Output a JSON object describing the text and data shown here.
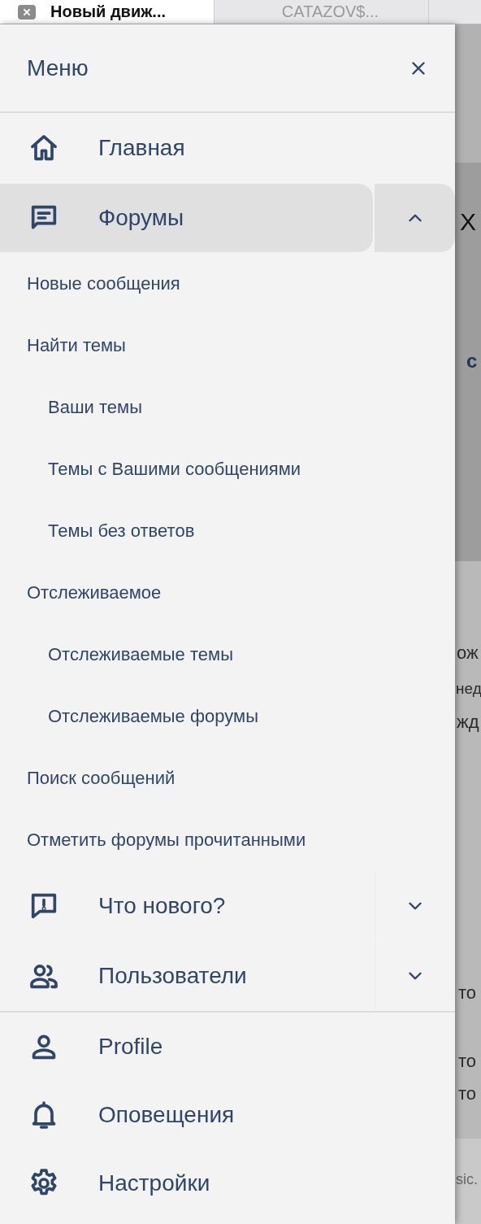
{
  "browser_tabs": [
    {
      "title": "Новый движ...",
      "selected": true
    },
    {
      "title": "CATAZOV$...",
      "selected": false
    }
  ],
  "menu": {
    "title": "Меню",
    "nav": [
      {
        "label": "Главная",
        "selected": false
      },
      {
        "label": "Форумы",
        "selected": true,
        "expanded": true,
        "children": [
          {
            "label": "Новые сообщения"
          },
          {
            "label": "Найти темы",
            "children": [
              {
                "label": "Ваши темы"
              },
              {
                "label": "Темы с Вашими сообщениями"
              },
              {
                "label": "Темы без ответов"
              }
            ]
          },
          {
            "label": "Отслеживаемое",
            "children": [
              {
                "label": "Отслеживаемые темы"
              },
              {
                "label": "Отслеживаемые форумы"
              }
            ]
          },
          {
            "label": "Поиск сообщений"
          },
          {
            "label": "Отметить форумы прочитанными"
          }
        ]
      },
      {
        "label": "Что нового?",
        "selected": false,
        "expanded": false
      },
      {
        "label": "Пользователи",
        "selected": false,
        "expanded": false
      }
    ],
    "account": [
      {
        "label": "Profile"
      },
      {
        "label": "Оповещения"
      },
      {
        "label": "Настройки"
      }
    ]
  },
  "background_page": {
    "fragments": [
      "Х",
      "с",
      "ож",
      "нед",
      "жд",
      "то",
      "то",
      "то",
      "sic."
    ]
  }
}
